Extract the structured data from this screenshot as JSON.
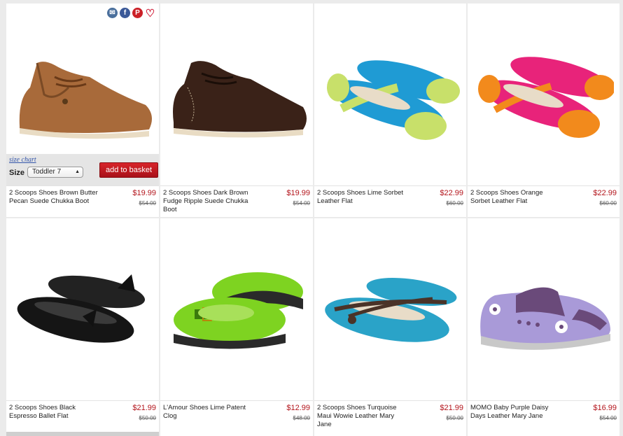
{
  "social": {
    "email_icon": "email-icon",
    "facebook_icon": "facebook-icon",
    "pinterest_icon": "pinterest-icon",
    "heart_icon": "heart-icon",
    "facebook_glyph": "f",
    "pinterest_glyph": "P"
  },
  "quick_buy": {
    "size_chart": "size chart",
    "size_label": "Size",
    "size_value": "Toddler 7",
    "add_to_basket": "add to basket"
  },
  "products": [
    {
      "name": "2 Scoops Shoes Brown Butter Pecan Suede Chukka Boot",
      "price": "$19.99",
      "original": "$54.00",
      "colors": [
        "#a86a3a",
        "#7a4a25"
      ]
    },
    {
      "name": "2 Scoops Shoes Dark Brown Fudge Ripple Suede Chukka Boot",
      "price": "$19.99",
      "original": "$54.00",
      "colors": [
        "#3a2218",
        "#241410"
      ]
    },
    {
      "name": "2 Scoops Shoes Lime Sorbet Leather Flat",
      "price": "$22.99",
      "original": "$60.00",
      "colors": [
        "#1f9bd4",
        "#c8e06a"
      ]
    },
    {
      "name": "2 Scoops Shoes Orange Sorbet Leather Flat",
      "price": "$22.99",
      "original": "$60.00",
      "colors": [
        "#e8237a",
        "#f28a1c"
      ]
    },
    {
      "name": "2 Scoops Shoes Black Espresso Ballet Flat",
      "price": "$21.99",
      "original": "$50.00",
      "colors": [
        "#151515",
        "#3a3a3a"
      ]
    },
    {
      "name": "L'Amour Shoes Lime Patent Clog",
      "price": "$12.99",
      "original": "$48.00",
      "colors": [
        "#7ed321",
        "#3a7a0c"
      ]
    },
    {
      "name": "2 Scoops Shoes Turquoise Maui Wowie Leather Mary Jane",
      "price": "$21.99",
      "original": "$50.00",
      "colors": [
        "#2aa3c8",
        "#4a3328"
      ]
    },
    {
      "name": "MOMO Baby Purple Daisy Days Leather Mary Jane",
      "price": "$16.99",
      "original": "$54.00",
      "colors": [
        "#a99ad8",
        "#6a4a7a"
      ]
    }
  ]
}
